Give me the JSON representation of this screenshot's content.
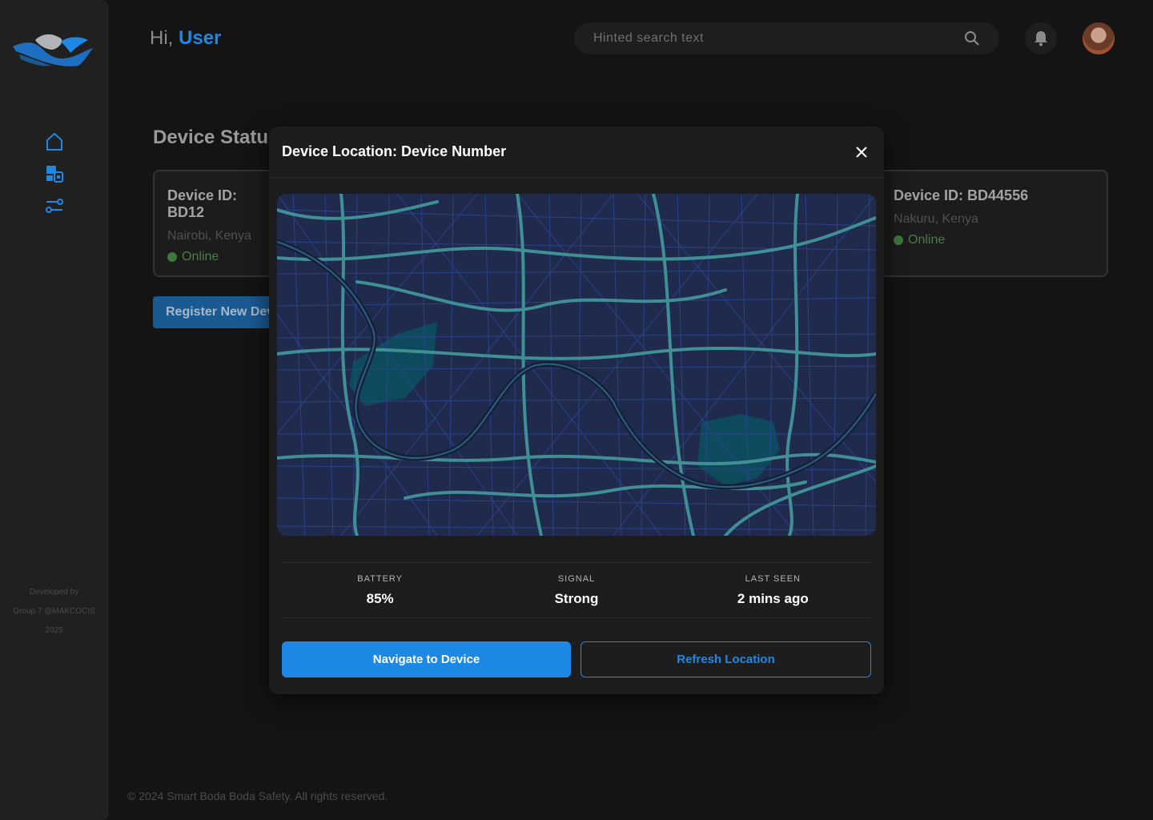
{
  "header": {
    "greeting_prefix": "Hi,",
    "user_name": "User",
    "search_placeholder": "Hinted search text"
  },
  "sidebar": {
    "items": [
      {
        "icon": "home-icon"
      },
      {
        "icon": "devices-icon"
      },
      {
        "icon": "route-icon"
      }
    ],
    "footer_line1": "Developed by",
    "footer_line2": "Group 7 @MAKCOCIS",
    "footer_line3": "2025"
  },
  "main": {
    "section_title": "Device Status",
    "cards": [
      {
        "device_id": "Device ID: BD12",
        "location": "Nairobi, Kenya",
        "status": "Online"
      },
      {
        "device_id": "Device ID: BD44556",
        "location": "Nakuru, Kenya",
        "status": "Online"
      }
    ],
    "register_label": "Register New Devi",
    "copyright": "© 2024 Smart Boda Boda Safety. All rights reserved."
  },
  "modal": {
    "title": "Device Location: Device Number",
    "stats": [
      {
        "label": "BATTERY",
        "value": "85%"
      },
      {
        "label": "SIGNAL",
        "value": "Strong"
      },
      {
        "label": "LAST SEEN",
        "value": "2 mins ago"
      }
    ],
    "navigate_label": "Navigate to Device",
    "refresh_label": "Refresh Location"
  },
  "colors": {
    "accent": "#1e88e5",
    "background": "#141414",
    "online": "#3e7a3e",
    "map_base": "#1f2a4d",
    "map_roads": "#3f8f95"
  }
}
